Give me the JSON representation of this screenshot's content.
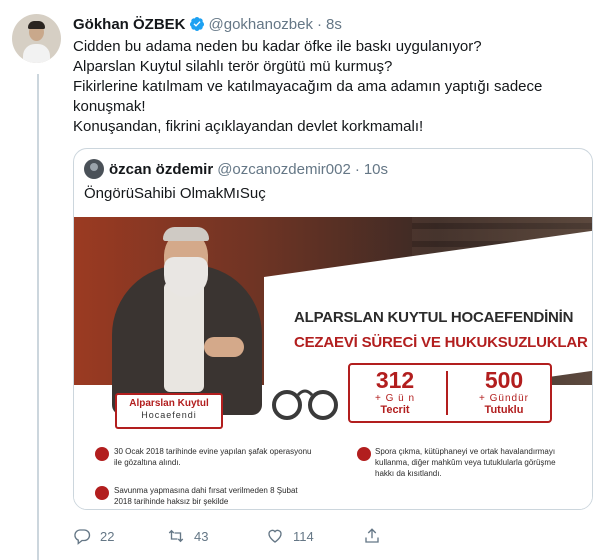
{
  "tweet": {
    "author_name": "Gökhan ÖZBEK",
    "author_handle": "@gokhanozbek",
    "separator": "·",
    "time": "8s",
    "lines": [
      "Cidden bu adama neden bu kadar öfke ile baskı uygulanıyor?",
      "Alparslan Kuytul silahlı terör örgütü mü kurmuş?",
      "Fikirlerine katılmam ve katılmayacağım da ama adamın yaptığı sadece",
      "konuşmak!",
      "Konuşandan, fikrini açıklayandan devlet korkmamalı!"
    ]
  },
  "quote": {
    "author_name": "özcan özdemir",
    "author_handle": "@ozcanozdemir002",
    "separator": "·",
    "time": "10s",
    "text": "ÖngörüSahibi OlmakMıSuç",
    "image": {
      "badge_line1": "Alparslan Kuytul",
      "badge_line2": "Hocaefendi",
      "title_line1": "ALPARSLAN KUYTUL HOCAEFENDİNİN",
      "title_line2": "CEZAEVİ SÜRECİ VE HUKUKSUZLUKLAR",
      "stat1_number": "312",
      "stat1_unit": "+ G ü n",
      "stat1_label": "Tecrit",
      "stat2_number": "500",
      "stat2_unit": "+ Gündür",
      "stat2_label": "Tutuklu",
      "info1": "30 Ocak 2018 tarihinde evine yapılan şafak operasyonu ile gözaltına alındı.",
      "info2": "Savunma yapmasına dahi fırsat verilmeden 8 Şubat 2018 tarihinde haksız bir şekilde",
      "info3": "Spora çıkma, kütüphaneyi ve ortak havalandırmayı kullanma, diğer mahkûm veya tutuklularla görüşme hakkı da kısıtlandı."
    }
  },
  "actions": {
    "reply_count": "22",
    "retweet_count": "43",
    "like_count": "114"
  },
  "icons": {
    "verified": "verified-badge-icon",
    "reply": "reply-icon",
    "retweet": "retweet-icon",
    "like": "heart-icon",
    "share": "share-icon"
  },
  "colors": {
    "text": "#14171a",
    "secondary": "#657786",
    "verified": "#1da1f2",
    "border": "#ccd6dd",
    "accent_red": "#b21e1e"
  }
}
